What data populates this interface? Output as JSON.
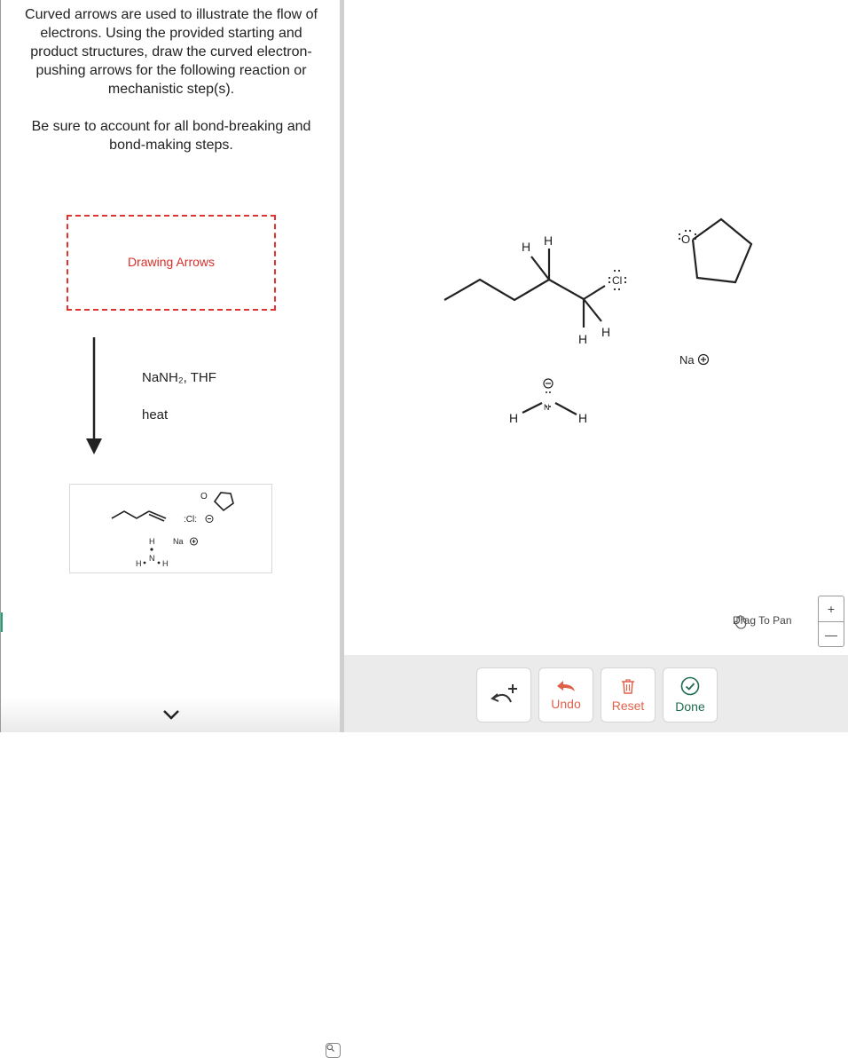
{
  "instructions": {
    "paragraph1": "Curved arrows are used to illustrate the flow of electrons. Using the provided starting and product structures, draw the curved electron-pushing arrows for the following reaction or mechanistic step(s).",
    "paragraph2": "Be sure to account for all bond-breaking and bond-making steps."
  },
  "drawing_box": {
    "label": "Drawing Arrows"
  },
  "reaction": {
    "reagent": "NaNH₂, THF",
    "condition": "heat"
  },
  "thumbnail": {
    "chloride_label": ":Cl:",
    "sodium_label": "Na",
    "h_label": "H",
    "n_label": "N",
    "o_label": "O"
  },
  "canvas": {
    "h_label": "H",
    "cl_label": "Cl",
    "n_label": "N",
    "o_label": "O",
    "sodium_label": "Na",
    "pan_hint": "Drag To Pan",
    "zoom_in": "+",
    "zoom_out": "—"
  },
  "toolbar": {
    "undo_label": "Undo",
    "reset_label": "Reset",
    "done_label": "Done"
  },
  "colors": {
    "accent_red": "#e2332f",
    "undo_reset": "#e0614a",
    "done_green": "#1d6b4e"
  },
  "icons": [
    "curved-arrow-add-icon",
    "undo-arrow-icon",
    "trash-icon",
    "check-circle-icon",
    "hand-icon",
    "zoom-icon",
    "chevron-down-icon"
  ]
}
